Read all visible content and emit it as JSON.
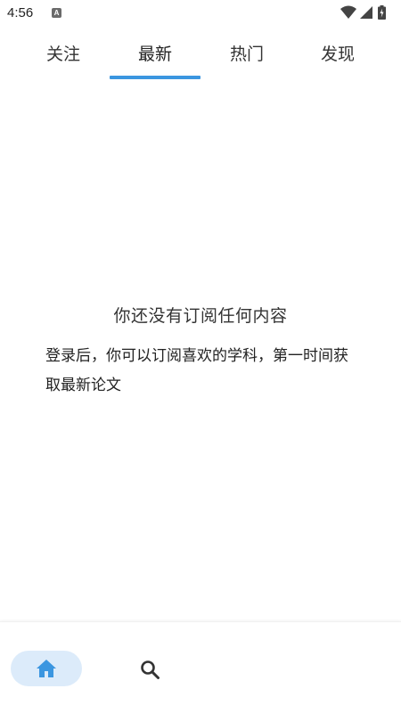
{
  "status_bar": {
    "time": "4:56",
    "app_icon_letter": "A"
  },
  "tabs": [
    {
      "label": "关注",
      "active": false
    },
    {
      "label": "最新",
      "active": true
    },
    {
      "label": "热门",
      "active": false
    },
    {
      "label": "发现",
      "active": false
    }
  ],
  "empty_state": {
    "title": "你还没有订阅任何内容",
    "description": "登录后，你可以订阅喜欢的学科，第一时间获取最新论文"
  },
  "bottom_nav": {
    "items": [
      {
        "icon": "home-icon",
        "active": true
      },
      {
        "icon": "search-icon",
        "active": false
      }
    ]
  },
  "colors": {
    "accent": "#3b96e0",
    "active_nav_bg": "#dcebfa"
  }
}
